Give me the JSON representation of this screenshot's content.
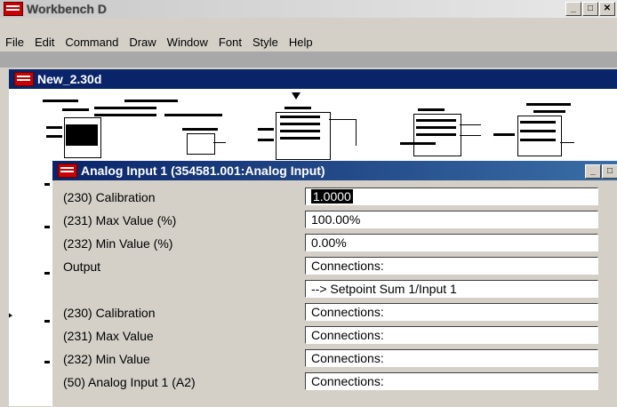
{
  "app": {
    "title": "Workbench D"
  },
  "menu": [
    "File",
    "Edit",
    "Command",
    "Draw",
    "Window",
    "Font",
    "Style",
    "Help"
  ],
  "child_window": {
    "title": "New_2.30d"
  },
  "dialog": {
    "title": "Analog Input 1 (354581.001:Analog Input)",
    "rows": [
      {
        "label": "(230) Calibration",
        "value": "1.0000"
      },
      {
        "label": "(231) Max Value (%)",
        "value": "100.00%"
      },
      {
        "label": "(232) Min Value (%)",
        "value": "0.00%"
      },
      {
        "label": "Output",
        "value": "Connections:"
      },
      {
        "label": "",
        "value": "--> Setpoint Sum 1/Input 1"
      },
      {
        "label": "(230) Calibration",
        "value": "Connections:"
      },
      {
        "label": "(231) Max Value",
        "value": "Connections:"
      },
      {
        "label": "(232) Min Value",
        "value": "Connections:"
      },
      {
        "label": "(50) Analog Input 1 (A2)",
        "value": "Connections:"
      }
    ]
  }
}
